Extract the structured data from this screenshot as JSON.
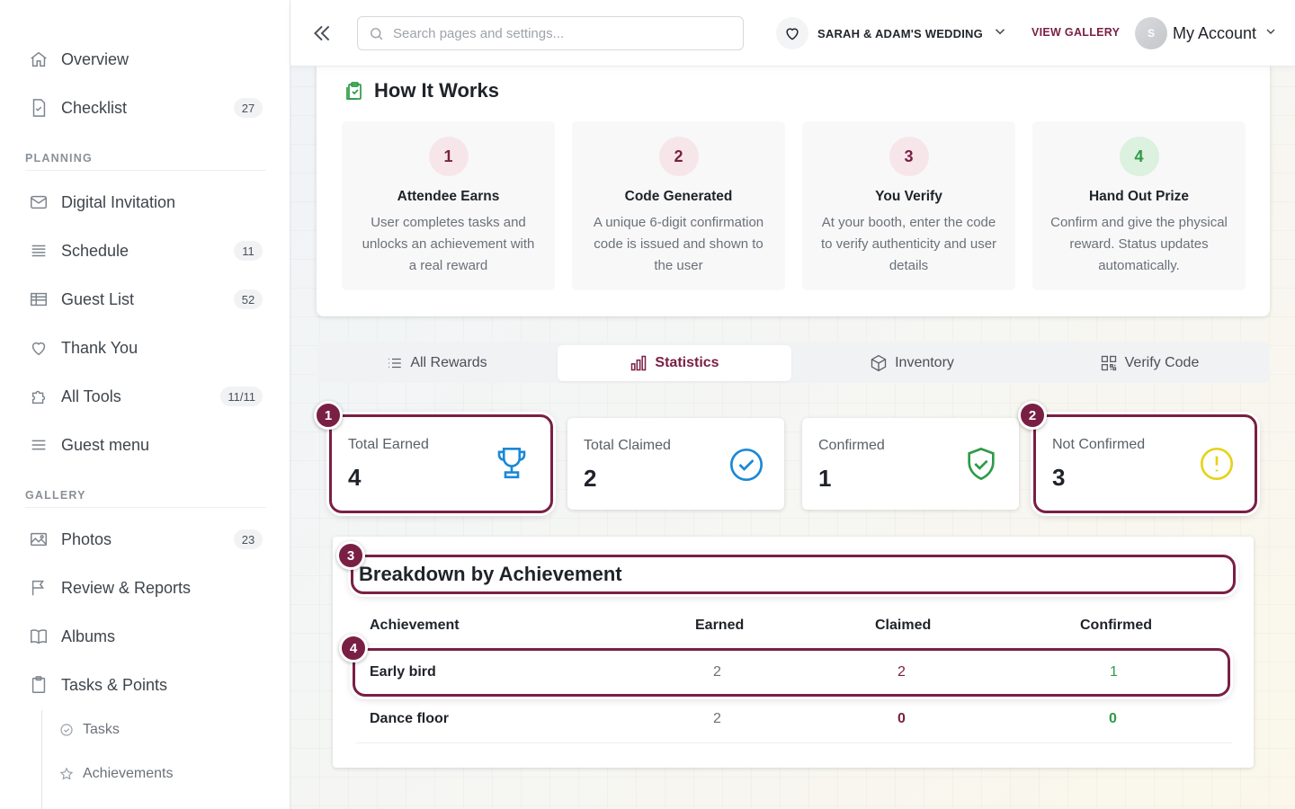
{
  "sidebar": {
    "items_top": [
      {
        "label": "Overview",
        "icon": "home-icon"
      },
      {
        "label": "Checklist",
        "icon": "checklist-icon",
        "badge": "27"
      }
    ],
    "planning_label": "PLANNING",
    "planning": [
      {
        "label": "Digital Invitation",
        "icon": "mail-icon"
      },
      {
        "label": "Schedule",
        "icon": "list-icon",
        "badge": "11"
      },
      {
        "label": "Guest List",
        "icon": "table-icon",
        "badge": "52"
      },
      {
        "label": "Thank You",
        "icon": "heart-icon"
      },
      {
        "label": "All Tools",
        "icon": "puzzle-icon",
        "badge": "11/11"
      },
      {
        "label": "Guest menu",
        "icon": "menu-icon"
      }
    ],
    "gallery_label": "GALLERY",
    "gallery": [
      {
        "label": "Photos",
        "icon": "image-icon",
        "badge": "23"
      },
      {
        "label": "Review & Reports",
        "icon": "flag-icon"
      },
      {
        "label": "Albums",
        "icon": "book-icon"
      },
      {
        "label": "Tasks & Points",
        "icon": "clipboard-icon"
      }
    ],
    "sub": [
      {
        "label": "Tasks",
        "icon": "check-circle-icon"
      },
      {
        "label": "Achievements",
        "icon": "star-icon"
      }
    ]
  },
  "header": {
    "search_placeholder": "Search pages and settings...",
    "event_name": "SARAH & ADAM'S WEDDING",
    "view_gallery": "VIEW GALLERY",
    "avatar_initial": "S",
    "account": "My Account"
  },
  "how_it_works": {
    "title": "How It Works",
    "steps": [
      {
        "num": "1",
        "title": "Attendee Earns",
        "desc": "User completes tasks and unlocks an achievement with a real reward",
        "bg": "#f6e6ea",
        "fg": "#7a1f44"
      },
      {
        "num": "2",
        "title": "Code Generated",
        "desc": "A unique 6-digit confirmation code is issued and shown to the user",
        "bg": "#f6e6ea",
        "fg": "#7a1f44"
      },
      {
        "num": "3",
        "title": "You Verify",
        "desc": "At your booth, enter the code to verify authenticity and user details",
        "bg": "#f6e6ea",
        "fg": "#7a1f44"
      },
      {
        "num": "4",
        "title": "Hand Out Prize",
        "desc": "Confirm and give the physical reward. Status updates automatically.",
        "bg": "#dcf1df",
        "fg": "#2e9b47"
      }
    ]
  },
  "tabs": [
    {
      "label": "All Rewards",
      "icon": "list-icon"
    },
    {
      "label": "Statistics",
      "icon": "bar-chart-icon",
      "active": true
    },
    {
      "label": "Inventory",
      "icon": "box-icon"
    },
    {
      "label": "Verify Code",
      "icon": "qr-icon"
    }
  ],
  "stats": [
    {
      "title": "Total Earned",
      "value": "4",
      "icon": "trophy-icon",
      "color": "#1a88d8"
    },
    {
      "title": "Total Claimed",
      "value": "2",
      "icon": "check-circle-icon",
      "color": "#1a88d8"
    },
    {
      "title": "Confirmed",
      "value": "1",
      "icon": "shield-check-icon",
      "color": "#2e9b47"
    },
    {
      "title": "Not Confirmed",
      "value": "3",
      "icon": "alert-circle-icon",
      "color": "#e6d21a"
    }
  ],
  "markers": [
    "1",
    "2",
    "3",
    "4"
  ],
  "breakdown": {
    "title": "Breakdown by Achievement",
    "headers": [
      "Achievement",
      "Earned",
      "Claimed",
      "Confirmed"
    ],
    "rows": [
      {
        "name": "Early bird",
        "earned": "2",
        "claimed": "2",
        "confirmed": "1"
      },
      {
        "name": "Dance floor",
        "earned": "2",
        "claimed": "0",
        "confirmed": "0"
      }
    ]
  }
}
